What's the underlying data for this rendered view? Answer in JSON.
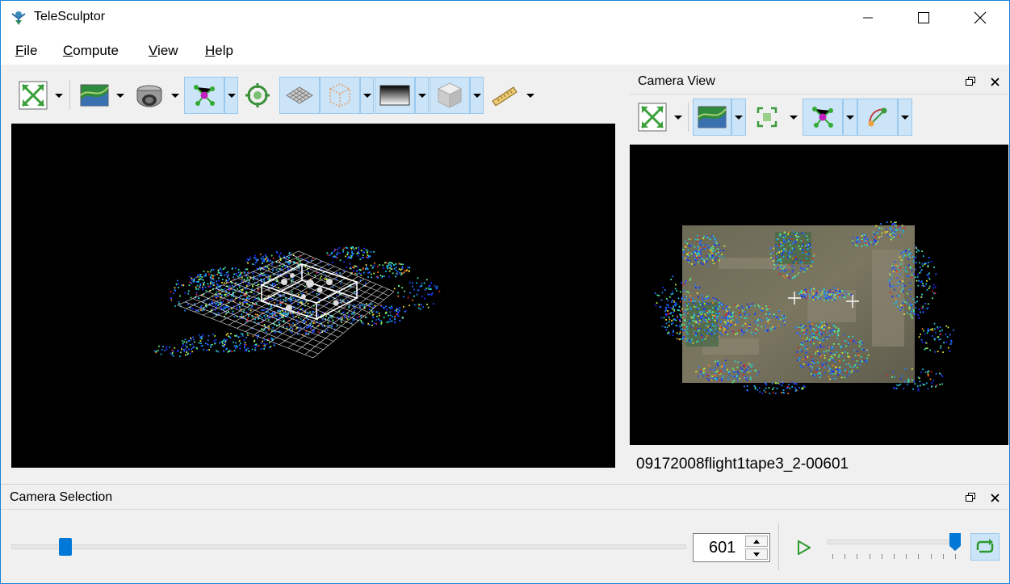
{
  "window": {
    "title": "TeleSculptor",
    "controls": [
      "minimize-icon",
      "maximize-icon",
      "close-icon"
    ]
  },
  "menu": {
    "items": [
      "File",
      "Compute",
      "View",
      "Help"
    ]
  },
  "world_toolbar": {
    "buttons": [
      {
        "icon": "reset-view-icon",
        "active": false,
        "dropdown": true
      },
      {
        "icon": "image-layer-icon",
        "active": false,
        "dropdown": true
      },
      {
        "icon": "camera-icon",
        "active": false,
        "dropdown": true
      },
      {
        "icon": "feature-points-icon",
        "active": true,
        "dropdown": true
      },
      {
        "icon": "target-icon",
        "active": false,
        "dropdown": false
      },
      {
        "icon": "ground-plane-icon",
        "active": true,
        "dropdown": false
      },
      {
        "icon": "roi-box-icon",
        "active": true,
        "dropdown": true
      },
      {
        "icon": "depth-map-icon",
        "active": true,
        "dropdown": true
      },
      {
        "icon": "surface-mesh-icon",
        "active": true,
        "dropdown": true
      },
      {
        "icon": "measure-ruler-icon",
        "active": false,
        "dropdown": true
      }
    ]
  },
  "camera_dock": {
    "title": "Camera View",
    "frame_name": "09172008flight1tape3_2-00601",
    "toolbar": [
      {
        "icon": "reset-view-icon",
        "active": false,
        "dropdown": true
      },
      {
        "icon": "image-layer-icon",
        "active": true,
        "dropdown": true
      },
      {
        "icon": "select-region-icon",
        "active": false,
        "dropdown": true
      },
      {
        "icon": "feature-points-icon",
        "active": true,
        "dropdown": true
      },
      {
        "icon": "residuals-icon",
        "active": true,
        "dropdown": true
      }
    ]
  },
  "selection_dock": {
    "title": "Camera Selection",
    "frame_value": "601",
    "frame_position_fraction": 0.072,
    "speed_fraction": 1.0,
    "play_icon": "play-icon",
    "loop_icon": "loop-icon"
  },
  "colors": {
    "accent": "#0078d7",
    "active_button_bg": "#cce4f7",
    "active_button_border": "#99c9ef",
    "window_border": "#1883d7"
  }
}
